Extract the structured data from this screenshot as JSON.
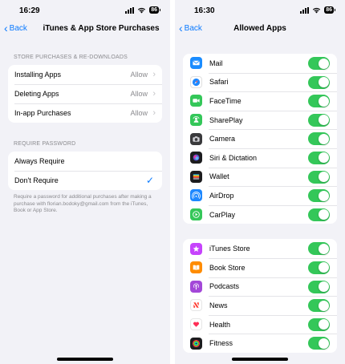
{
  "left": {
    "status": {
      "time": "16:29",
      "battery": "86"
    },
    "nav": {
      "back_label": "Back",
      "title": "iTunes & App Store Purchases"
    },
    "section1": {
      "header": "STORE PURCHASES & RE-DOWNLOADS",
      "rows": [
        {
          "label": "Installing Apps",
          "value": "Allow"
        },
        {
          "label": "Deleting Apps",
          "value": "Allow"
        },
        {
          "label": "In-app Purchases",
          "value": "Allow"
        }
      ]
    },
    "section2": {
      "header": "REQUIRE PASSWORD",
      "rows": [
        {
          "label": "Always Require",
          "selected": false
        },
        {
          "label": "Don't Require",
          "selected": true
        }
      ],
      "footer": "Require a password for additional purchases after making a purchase with florian.bodoky@gmail.com from the iTunes, Book or App Store."
    }
  },
  "right": {
    "status": {
      "time": "16:30",
      "battery": "86"
    },
    "nav": {
      "back_label": "Back",
      "title": "Allowed Apps"
    },
    "group1": [
      {
        "label": "Mail",
        "icon": "mail-icon",
        "color": "#1a8cff",
        "on": true
      },
      {
        "label": "Safari",
        "icon": "safari-icon",
        "color": "#1e88ff",
        "on": true
      },
      {
        "label": "FaceTime",
        "icon": "facetime-icon",
        "color": "#34c759",
        "on": true
      },
      {
        "label": "SharePlay",
        "icon": "shareplay-icon",
        "color": "#34c759",
        "on": true
      },
      {
        "label": "Camera",
        "icon": "camera-icon",
        "color": "#3a3a3c",
        "on": true
      },
      {
        "label": "Siri & Dictation",
        "icon": "siri-icon",
        "color": "#1c1c1e",
        "on": true
      },
      {
        "label": "Wallet",
        "icon": "wallet-icon",
        "color": "#1c1c1e",
        "on": true
      },
      {
        "label": "AirDrop",
        "icon": "airdrop-icon",
        "color": "#1e88ff",
        "on": true
      },
      {
        "label": "CarPlay",
        "icon": "carplay-icon",
        "color": "#34c759",
        "on": true
      }
    ],
    "group2": [
      {
        "label": "iTunes Store",
        "icon": "itunes-store-icon",
        "color": "#c643fc",
        "on": true
      },
      {
        "label": "Book Store",
        "icon": "book-store-icon",
        "color": "#ff8c00",
        "on": true
      },
      {
        "label": "Podcasts",
        "icon": "podcasts-icon",
        "color": "#a347d8",
        "on": true
      },
      {
        "label": "News",
        "icon": "news-icon",
        "color": "#ffffff",
        "on": true
      },
      {
        "label": "Health",
        "icon": "health-icon",
        "color": "#ffffff",
        "on": true
      },
      {
        "label": "Fitness",
        "icon": "fitness-icon",
        "color": "#1c1c1e",
        "on": true
      }
    ]
  },
  "colors": {
    "accent": "#0a7aff",
    "toggle_on": "#34c759",
    "background": "#f2f2f7"
  }
}
